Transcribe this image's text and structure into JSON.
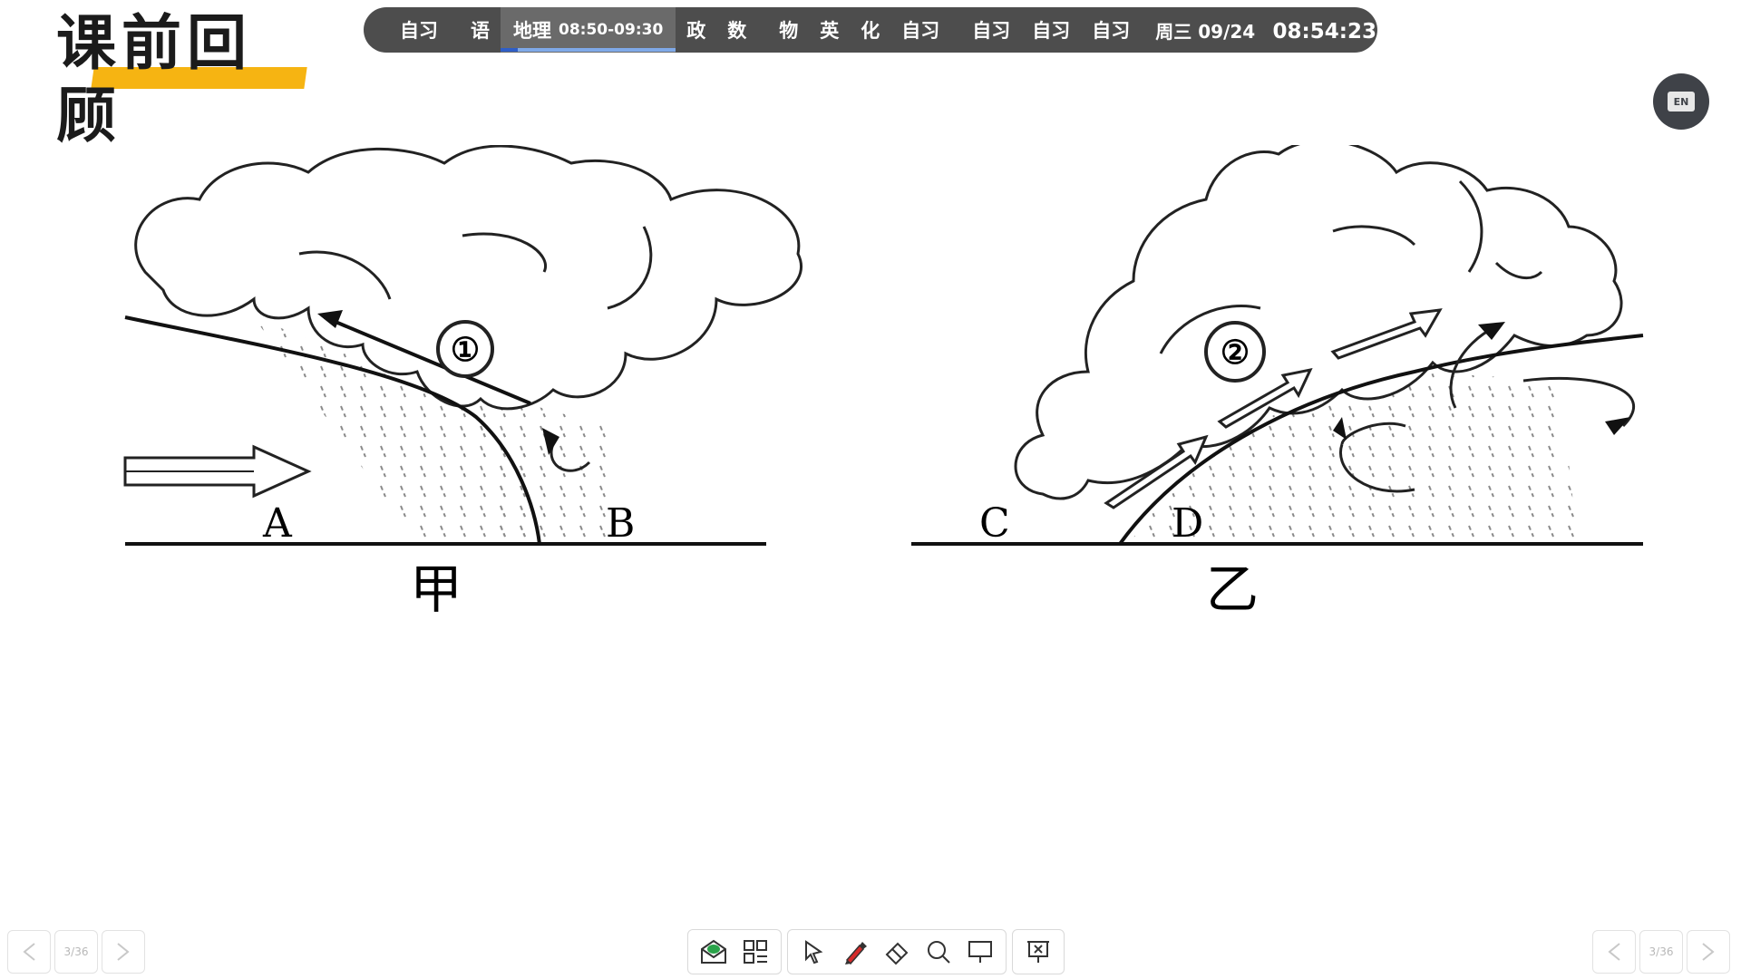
{
  "header": {
    "title": "课前回顾"
  },
  "schedule": {
    "slots": [
      {
        "label": "自习"
      },
      {
        "label": "语"
      },
      {
        "label": "地理",
        "time": "08:50-09:30",
        "current": true
      },
      {
        "label": "政"
      },
      {
        "label": "数"
      },
      {
        "label": "物"
      },
      {
        "label": "英"
      },
      {
        "label": "化"
      },
      {
        "label": "自习"
      },
      {
        "label": "自习"
      },
      {
        "label": "自习"
      },
      {
        "label": "自习"
      }
    ],
    "date": "周三 09/24",
    "clock": "08:54:23",
    "progress_fraction": 0.1
  },
  "lang_button": {
    "label": "EN"
  },
  "diagram_left": {
    "caption": "甲",
    "labels": {
      "circle": "①",
      "a": "A",
      "b": "B"
    }
  },
  "diagram_right": {
    "caption": "乙",
    "labels": {
      "circle": "②",
      "c": "C",
      "d": "D"
    }
  },
  "pagination": {
    "left": "3/36",
    "right": "3/36"
  },
  "toolbar": {
    "icons": [
      "envelope-icon",
      "grid-icon",
      "cursor-icon",
      "pen-icon",
      "eraser-icon",
      "magnifier-icon",
      "screen-icon",
      "close-screen-icon"
    ]
  },
  "colors": {
    "title_underline": "#F6B412",
    "bar_bg": "#4d4d4d",
    "progress": "#2f5ec7",
    "pen": "#d62b2b"
  }
}
